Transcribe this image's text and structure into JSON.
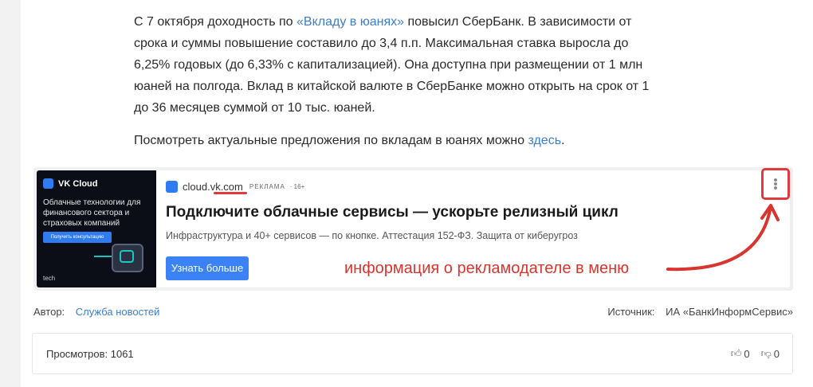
{
  "article": {
    "p1_before": "С 7 октября доходность по ",
    "p1_link": "«Вкладу в юанях»",
    "p1_after": " повысил СберБанк. В зависимости от",
    "p1_line2": "срока и суммы повышение составило до 3,4 п.п. Максимальная ставка выросла до",
    "p1_line3": "6,25% годовых (до 6,33% с капитализацией). Она доступна при размещении от 1 млн",
    "p1_line4": "юаней на полгода. Вклад в китайской валюте в СберБанке можно открыть на срок от 1",
    "p1_line5": "до 36 месяцев суммой от 10 тыс. юаней.",
    "p2_before": "Посмотреть актуальные предложения по вкладам в юанях можно ",
    "p2_link": "здесь",
    "p2_after": "."
  },
  "ad": {
    "banner": {
      "brand": "VK Cloud",
      "text": "Облачные технологии для финансового сектора и страховых компаний",
      "button": "Получить консультацию",
      "tech": "tech"
    },
    "source": "cloud.vk.com",
    "label": "РЕКЛАМА",
    "age": "· 16+",
    "title": "Подключите облачные сервисы — ускорьте релизный цикл",
    "description": "Инфраструктура и 40+ сервисов — по кнопке. Аттестация 152-ФЗ. Защита от киберугроз",
    "button": "Узнать больше",
    "menu_icon": "more-vertical-icon"
  },
  "annotation": {
    "text": "информация о рекламодателе в меню",
    "color": "#d8352f"
  },
  "meta": {
    "author_label": "Автор:",
    "author_name": "Служба новостей",
    "source_label": "Источник:",
    "source_name": "ИА «БанкИнформСервис»"
  },
  "stats": {
    "views_label": "Просмотров: 1061",
    "likes": "0",
    "dislikes": "0"
  },
  "colors": {
    "link": "#3d7ec9",
    "ad_button": "#3b82f6",
    "highlight": "#e0393e"
  }
}
